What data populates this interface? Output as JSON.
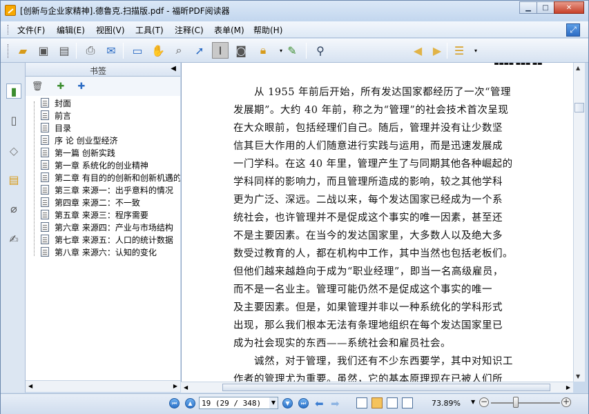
{
  "window": {
    "title": "[创新与企业家精神].德鲁克.扫描版.pdf - 福昕PDF阅读器"
  },
  "menu": {
    "items": [
      "文件(F)",
      "编辑(E)",
      "视图(V)",
      "工具(T)",
      "注释(C)",
      "表单(M)",
      "帮助(H)"
    ]
  },
  "toolbar": {
    "search_value": "",
    "icons": [
      "open-folder-icon",
      "save-icon",
      "save-as-icon",
      "print-icon",
      "email-icon",
      "fullscreen-icon",
      "hand-tool-icon",
      "snapshot-zoom-icon",
      "select-arrow-icon",
      "text-select-icon",
      "camera-icon",
      "rms-lock-icon",
      "sign-icon",
      "find-binoculars-icon",
      "prev-match-icon",
      "next-match-icon",
      "highlight-icon"
    ]
  },
  "bookmarks": {
    "title": "书签",
    "items": [
      "封面",
      "前言",
      "目录",
      "序 论 创业型经济",
      "第一篇 创新实践",
      "第一章 系统化的创业精神",
      "第二章 有目的的创新和创新机遇的",
      "第三章 来源一：出乎意料的情况",
      "第四章 来源二：不一致",
      "第五章 来源三：程序需要",
      "第六章 来源四：产业与市场结构",
      "第七章 来源五：人口的统计数据",
      "第八章 来源六：认知的变化"
    ]
  },
  "document": {
    "top_fragment": "▪▪▪▪ ▪▪▪ ▪▪",
    "lines": [
      "从 1955 年前后开始，所有发达国家都经历了一次“管理",
      "发展期”。大约 40 年前，称之为“管理”的社会技术首次呈现",
      "在大众眼前，包括经理们自己。随后，管理并没有让少数坚",
      "信其巨大作用的人们随意进行实践与运用，而是迅速发展成",
      "一门学科。在这 40 年里，管理产生了与同期其他各种崛起的",
      "学科同样的影响力，而且管理所造成的影响，较之其他学科",
      "更为广泛、深远。二战以来，每个发达国家已经成为一个系",
      "统社会，也许管理并不是促成这个事实的唯一因素，甚至还",
      "不是主要因素。在当今的发达国家里，大多数人以及绝大多",
      "数受过教育的人，都在机构中工作，其中当然也包括老板们。",
      "但他们越来越趋向于成为“职业经理”，即当一名高级雇员，",
      "而不是一名业主。管理可能仍然不是促成这个事实的唯一",
      "及主要因素。但是，如果管理并非以一种系统化的学科形式",
      "出现，那么我们根本无法有条理地组织在每个发达国家里已",
      "成为社会现实的东西——系统社会和雇员社会。",
      "诚然，对于管理，我们还有不少东西要学，其中对知识工",
      "作者的管理尤为重要。虽然，它的基本原理现在已被人们所"
    ]
  },
  "status": {
    "page_field": "19 (29 / 348)",
    "zoom": "73.89%"
  }
}
